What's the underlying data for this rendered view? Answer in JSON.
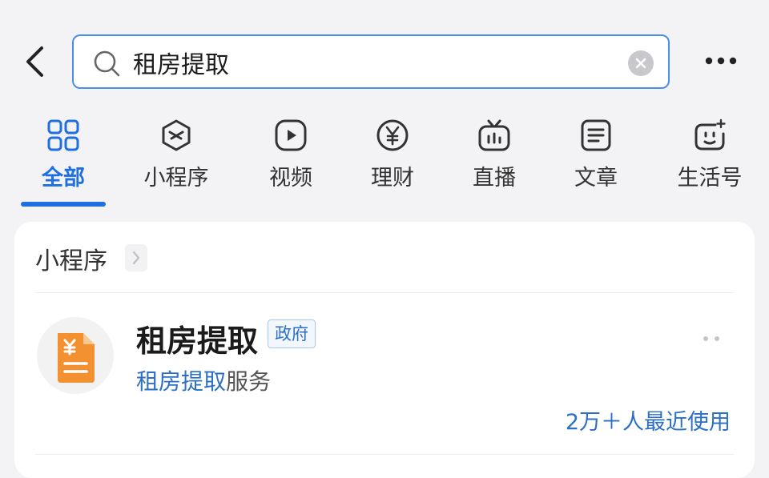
{
  "search": {
    "value": "租房提取"
  },
  "tabs": [
    {
      "label": "全部",
      "icon": "grid-icon",
      "active": true
    },
    {
      "label": "小程序",
      "icon": "mini-program-icon"
    },
    {
      "label": "视频",
      "icon": "play-icon"
    },
    {
      "label": "理财",
      "icon": "yen-icon"
    },
    {
      "label": "直播",
      "icon": "tv-icon"
    },
    {
      "label": "文章",
      "icon": "document-icon"
    },
    {
      "label": "生活号",
      "icon": "life-account-icon"
    }
  ],
  "section": {
    "title": "小程序"
  },
  "result": {
    "name": "租房提取",
    "badge": "政府",
    "desc_highlight": "租房提取",
    "desc_rest": "服务",
    "usage": "2万＋人最近使用",
    "logo_icon": "yen-document-icon"
  },
  "colors": {
    "accent": "#1f6fe0",
    "logo_orange": "#f3902f",
    "highlight_blue": "#2b6fc6"
  }
}
